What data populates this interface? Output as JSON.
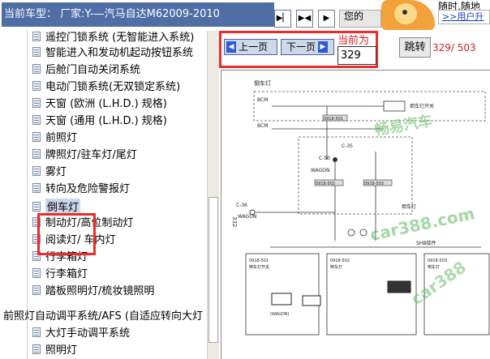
{
  "header": {
    "car_model": "当前车型：  厂家:Y-—汽马自达M62009-2010",
    "partial_text": "您的",
    "ad_line1": "随时,随地",
    "ad_line2": ">>用户升"
  },
  "toolbar": {
    "prev_label": "上一页",
    "next_label": "下一页",
    "current_label": "当前为",
    "current_page": "329",
    "jump_label": "跳转",
    "page_count": "329/ 503"
  },
  "tree": {
    "items": [
      "遥控门锁系统 (无智能进入系统)",
      "智能进入和发动机起动按钮系统",
      "后舱门自动关闭系统",
      "电动门锁系统(无双锁定系统)",
      "天窗   (欧洲 (L.H.D.) 规格)",
      "天窗   (通用 (L.H.D.) 规格)",
      "前照灯",
      "牌照灯/驻车灯/尾灯",
      "雾灯",
      "转向及危险警报灯",
      "倒车灯",
      "制动灯/高位制动灯",
      "阅读灯/ 车内灯",
      "行李箱灯",
      "行李箱灯",
      "踏板照明灯/梳妆镜照明"
    ],
    "parent_item": "前照灯自动调平系统/AFS (自适应转向大灯",
    "sub_items": [
      "大灯手动调平系统",
      "照明灯"
    ]
  },
  "diagram": {
    "title": "倒车灯",
    "page_number": "332",
    "labels": {
      "bcm": "BCM",
      "wagon": "WAGON",
      "c35": "C-35",
      "c36": "C-36",
      "c50": "C-50",
      "shb": "SHB接件",
      "conn1": "0918-501",
      "conn2": "0918-502",
      "conn3": "0918-503",
      "switch": "倒车灯开关",
      "lamp": "倒车灯",
      "wagon_paren": "(WAGON)"
    },
    "watermarks": [
      "畅易汽车",
      "car388.com",
      "car388"
    ]
  },
  "colors": {
    "title_bg": "#4f6ea6",
    "highlight_red": "#ee2a2a",
    "page_count_red": "#d02020",
    "watermark_green": "#5cb85c"
  }
}
